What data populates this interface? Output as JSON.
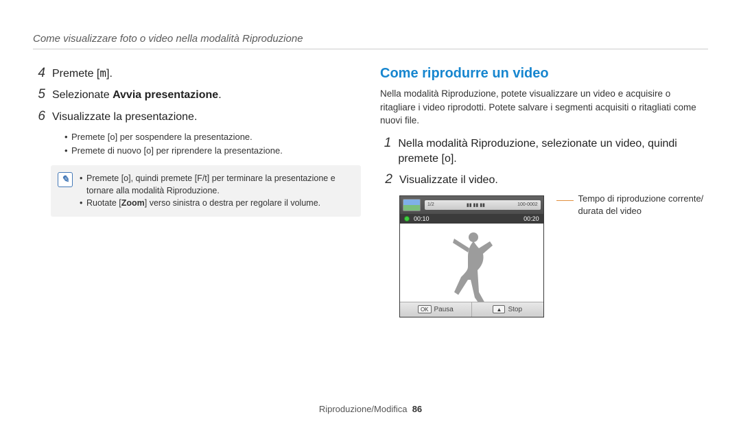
{
  "header": "Come visualizzare foto o video nella modalità Riproduzione",
  "left": {
    "step4": {
      "num": "4",
      "line": "Premete [",
      "glyph": "m",
      "after": "]."
    },
    "step5": {
      "num": "5",
      "prefix": "Selezionate ",
      "bold": "Avvia presentazione",
      "suffix": "."
    },
    "step6": {
      "num": "6",
      "line": "Visualizzate la presentazione."
    },
    "sub6": [
      "Premete [o] per sospendere la presentazione.",
      "Premete di nuovo [o] per riprendere la presentazione."
    ],
    "note": [
      "Premete [o], quindi premete [F/t] per terminare la presentazione e tornare alla modalità Riproduzione.",
      "Ruotate [Zoom] verso sinistra o destra per regolare il volume."
    ],
    "zoom_label": "Zoom"
  },
  "right": {
    "heading": "Come riprodurre un video",
    "intro": "Nella modalità Riproduzione, potete visualizzare un video e acquisire o ritagliare i video riprodotti. Potete salvare i segmenti acquisiti o ritagliati come nuovi file.",
    "step1": {
      "num": "1",
      "line": "Nella modalità Riproduzione, selezionate un video, quindi premete [o]."
    },
    "step2": {
      "num": "2",
      "line": "Visualizzate il video."
    },
    "video": {
      "counter": "1/2",
      "status_icons": "100-0002",
      "time_current": "00:10",
      "time_total": "00:20",
      "btn_ok": "OK",
      "btn_pause": "Pausa",
      "btn_stop": "Stop"
    },
    "callout": "Tempo di riproduzione corrente/ durata del video"
  },
  "footer": {
    "section": "Riproduzione/Modifica",
    "page": "86"
  }
}
